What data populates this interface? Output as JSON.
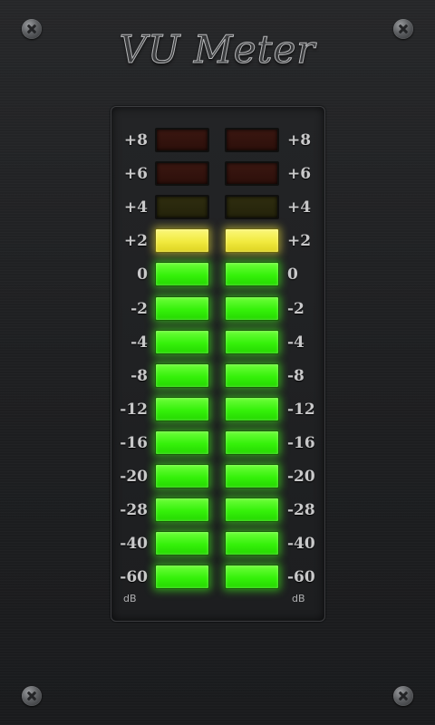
{
  "title": "VU Meter",
  "unit_label": "dB",
  "scale": [
    {
      "db": "+8",
      "left": "off",
      "right": "off",
      "color": "red"
    },
    {
      "db": "+6",
      "left": "off",
      "right": "off",
      "color": "red"
    },
    {
      "db": "+4",
      "left": "off",
      "right": "off",
      "color": "yellow"
    },
    {
      "db": "+2",
      "left": "on",
      "right": "on",
      "color": "yellow"
    },
    {
      "db": "0",
      "left": "on",
      "right": "on",
      "color": "green"
    },
    {
      "db": "-2",
      "left": "on",
      "right": "on",
      "color": "green"
    },
    {
      "db": "-4",
      "left": "on",
      "right": "on",
      "color": "green"
    },
    {
      "db": "-8",
      "left": "on",
      "right": "on",
      "color": "green"
    },
    {
      "db": "-12",
      "left": "on",
      "right": "on",
      "color": "green"
    },
    {
      "db": "-16",
      "left": "on",
      "right": "on",
      "color": "green"
    },
    {
      "db": "-20",
      "left": "on",
      "right": "on",
      "color": "green"
    },
    {
      "db": "-28",
      "left": "on",
      "right": "on",
      "color": "green"
    },
    {
      "db": "-40",
      "left": "on",
      "right": "on",
      "color": "green"
    },
    {
      "db": "-60",
      "left": "on",
      "right": "on",
      "color": "green"
    }
  ],
  "colors": {
    "led_green_on": "#35f10a",
    "led_yellow_on": "#f1ea3f",
    "led_yellow_off": "#2f2d0f",
    "led_red_off": "#3b1711",
    "label_text": "#c9c9ca",
    "background": "#1e1f21"
  }
}
